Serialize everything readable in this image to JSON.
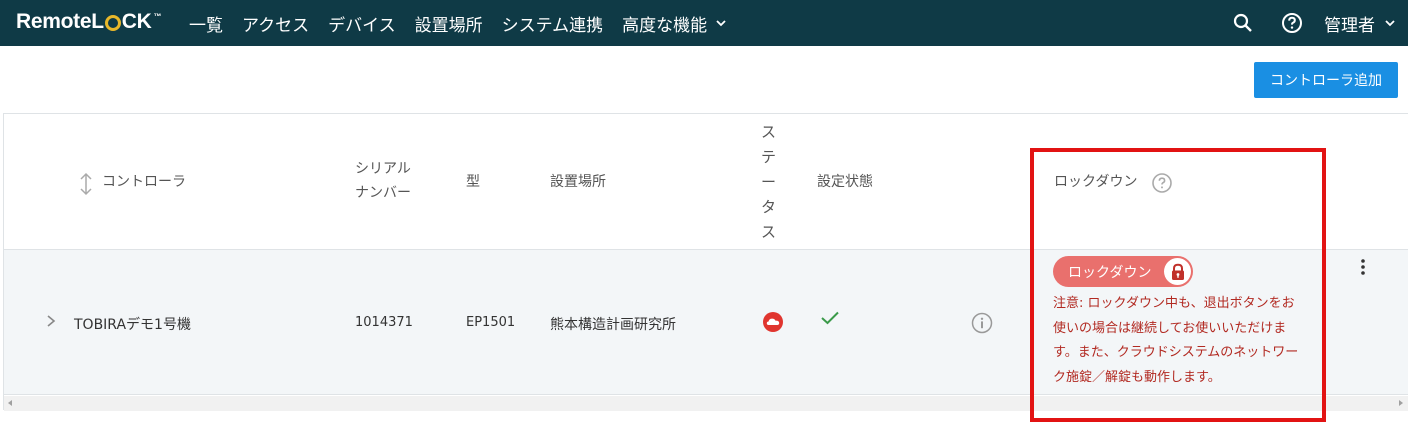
{
  "app": {
    "logo_text_left": "Remote",
    "logo_text_l": "L",
    "logo_text_ck": "CK",
    "logo_tm": "™"
  },
  "nav": {
    "items": [
      {
        "label": "一覧"
      },
      {
        "label": "アクセス"
      },
      {
        "label": "デバイス"
      },
      {
        "label": "設置場所"
      },
      {
        "label": "システム連携"
      },
      {
        "label": "高度な機能"
      }
    ],
    "admin_label": "管理者"
  },
  "toolbar": {
    "add_controller_label": "コントローラ追加"
  },
  "table": {
    "headers": {
      "controller": "コントローラ",
      "serial_line1": "シリアル",
      "serial_line2": "ナンバー",
      "model": "型",
      "location": "設置場所",
      "status_chars": [
        "ス",
        "テ",
        "ー",
        "タ",
        "ス"
      ],
      "config_state": "設定状態",
      "lockdown": "ロックダウン"
    },
    "rows": [
      {
        "controller": "TOBIRAデモ1号機",
        "serial": "1014371",
        "model": "EP1501",
        "location": "熊本構造計画研究所",
        "status_icon": "cloud-alert-icon",
        "config_icon": "check-icon",
        "lockdown_badge": "ロックダウン",
        "lockdown_notice": "注意: ロックダウン中も、退出ボタンをお使いの場合は継続してお使いいただけます。また、クラウドシステムのネットワーク施錠／解錠も動作します。"
      }
    ]
  },
  "colors": {
    "topbar": "#0f3a46",
    "primary_button": "#1a8fe3",
    "lockdown_badge": "#e9706d",
    "lockdown_lock": "#c0302a",
    "notice_text": "#b22a22",
    "status_red": "#e0352f",
    "check_green": "#3a9a4a",
    "highlight_box": "#e21313"
  }
}
